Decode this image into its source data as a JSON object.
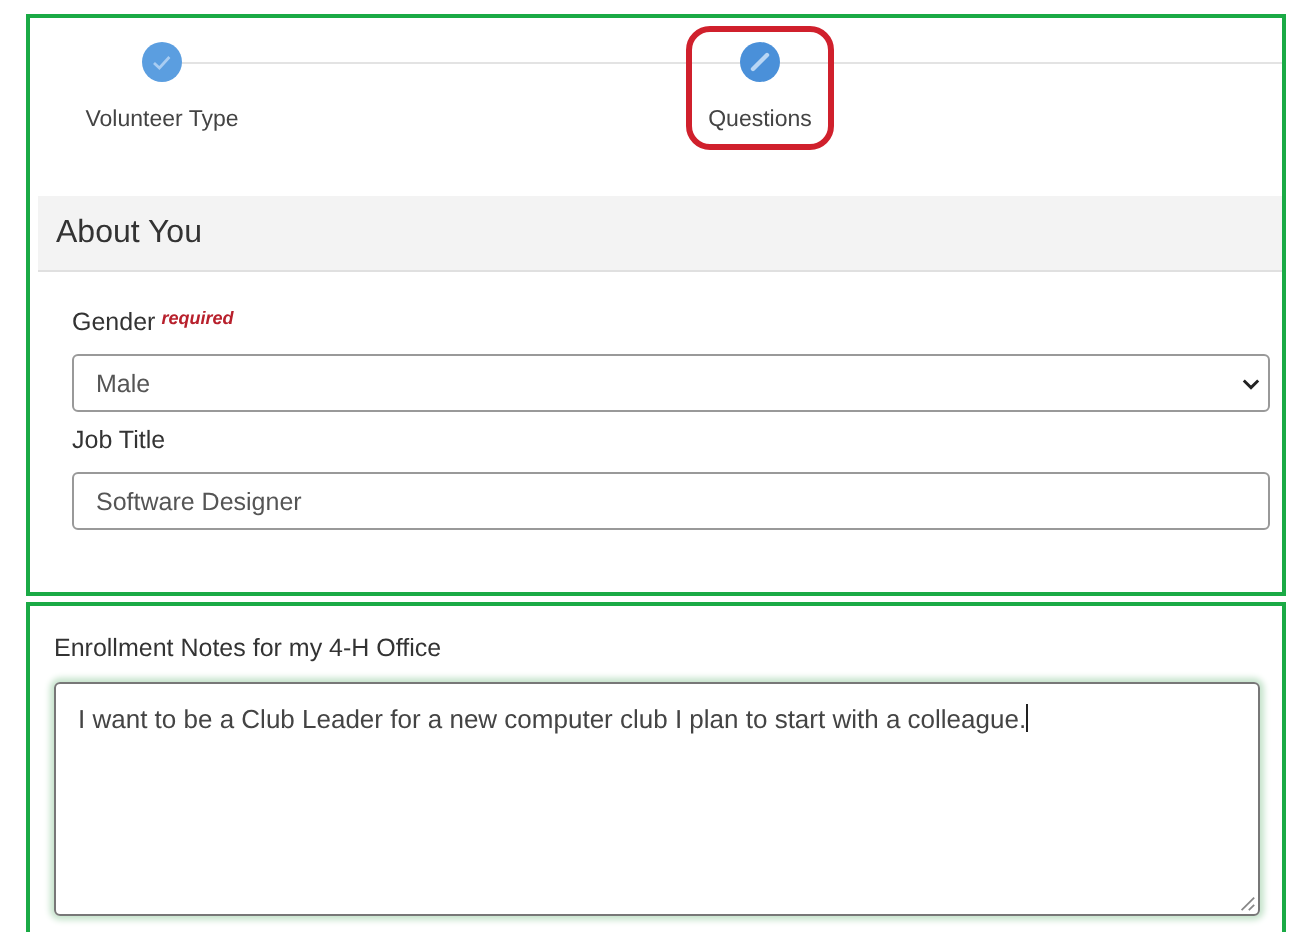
{
  "steps": [
    {
      "label": "Volunteer Type",
      "kind": "done",
      "selected": false,
      "highlighted": false
    },
    {
      "label": "Questions",
      "kind": "editing",
      "selected": true,
      "highlighted": true
    }
  ],
  "section": {
    "title": "About You"
  },
  "fields": [
    {
      "kind": "select",
      "label": "Gender",
      "required_note": "required",
      "value": "Male"
    },
    {
      "kind": "text",
      "label": "Job Title",
      "value": "Software Designer"
    }
  ],
  "notes": {
    "label": "Enrollment Notes for my 4-H Office",
    "value": "I want to be a Club Leader for a new computer club I plan to start with a colleague."
  }
}
